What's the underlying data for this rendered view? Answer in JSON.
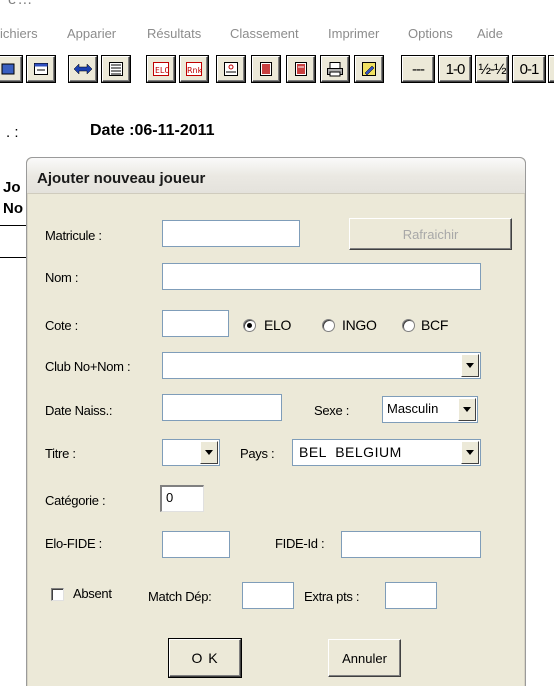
{
  "window": {
    "title_fragment": "e…"
  },
  "menu": {
    "items": [
      {
        "label": "ichiers"
      },
      {
        "label": "Apparier"
      },
      {
        "label": "Résultats"
      },
      {
        "label": "Classement"
      },
      {
        "label": "Imprimer"
      },
      {
        "label": "Options"
      },
      {
        "label": "Aide"
      }
    ]
  },
  "toolbar": {
    "buttons": [
      {
        "icon": "open-icon"
      },
      {
        "icon": "window-icon"
      },
      {
        "icon": "swap-arrows-icon"
      },
      {
        "icon": "list-icon"
      },
      {
        "icon": "elo-icon",
        "text": "ELO"
      },
      {
        "icon": "rnk-icon",
        "text": "Rnk"
      },
      {
        "icon": "card-icon"
      },
      {
        "icon": "sheet-icon"
      },
      {
        "icon": "sheet2-icon"
      },
      {
        "icon": "printer-icon"
      },
      {
        "icon": "edit-icon"
      }
    ],
    "result_buttons": [
      "---",
      "1-0",
      "½-½",
      "0-1",
      "1-"
    ]
  },
  "header": {
    "dot_label": ". :",
    "date_label": "Date :06-11-2011",
    "side_top": "Jo",
    "side_bottom": "No"
  },
  "dialog": {
    "title": "Ajouter nouveau joueur",
    "matricule_label": "Matricule :",
    "matricule_value": "",
    "refresh_button": "Rafraichir",
    "nom_label": "Nom :",
    "nom_value": "",
    "cote_label": "Cote :",
    "cote_value": "",
    "rating_options": [
      {
        "label": "ELO",
        "selected": true
      },
      {
        "label": "INGO",
        "selected": false
      },
      {
        "label": "BCF",
        "selected": false
      }
    ],
    "club_label": "Club No+Nom :",
    "club_value": "",
    "date_naiss_label": "Date Naiss.:",
    "date_naiss_value": "",
    "sexe_label": "Sexe :",
    "sexe_value": "Masculin",
    "titre_label": "Titre :",
    "titre_value": "",
    "pays_label": "Pays :",
    "pays_value": "BEL  BELGIUM",
    "categorie_label": "Catégorie :",
    "categorie_value": "0",
    "elo_fide_label": "Elo-FIDE :",
    "elo_fide_value": "",
    "fide_id_label": "FIDE-Id :",
    "fide_id_value": "",
    "absent_label": "Absent",
    "absent_checked": false,
    "match_dep_label": "Match Dép:",
    "match_dep_value": "",
    "extra_pts_label": "Extra pts :",
    "extra_pts_value": "",
    "ok_button": "O K",
    "cancel_button": "Annuler"
  }
}
